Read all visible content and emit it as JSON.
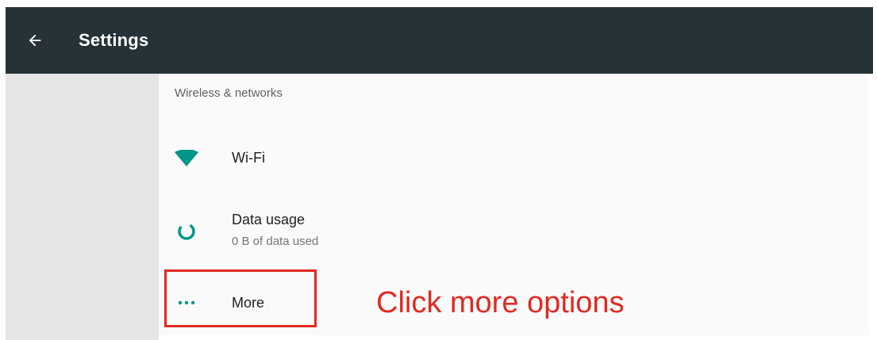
{
  "app_bar": {
    "title": "Settings",
    "back_icon": "arrow-back-icon",
    "background": "#263238"
  },
  "section": {
    "header": "Wireless & networks"
  },
  "items": [
    {
      "icon": "wifi-icon",
      "title": "Wi-Fi",
      "summary": ""
    },
    {
      "icon": "data-usage-icon",
      "title": "Data usage",
      "summary": "0 B of data used"
    },
    {
      "icon": "more-dots-icon",
      "title": "More",
      "summary": ""
    }
  ],
  "annotation": {
    "text": "Click more options",
    "color": "#e12a22"
  },
  "colors": {
    "accent": "#009688",
    "side_panel": "#e5e5e5",
    "content_bg": "#fafafa"
  }
}
